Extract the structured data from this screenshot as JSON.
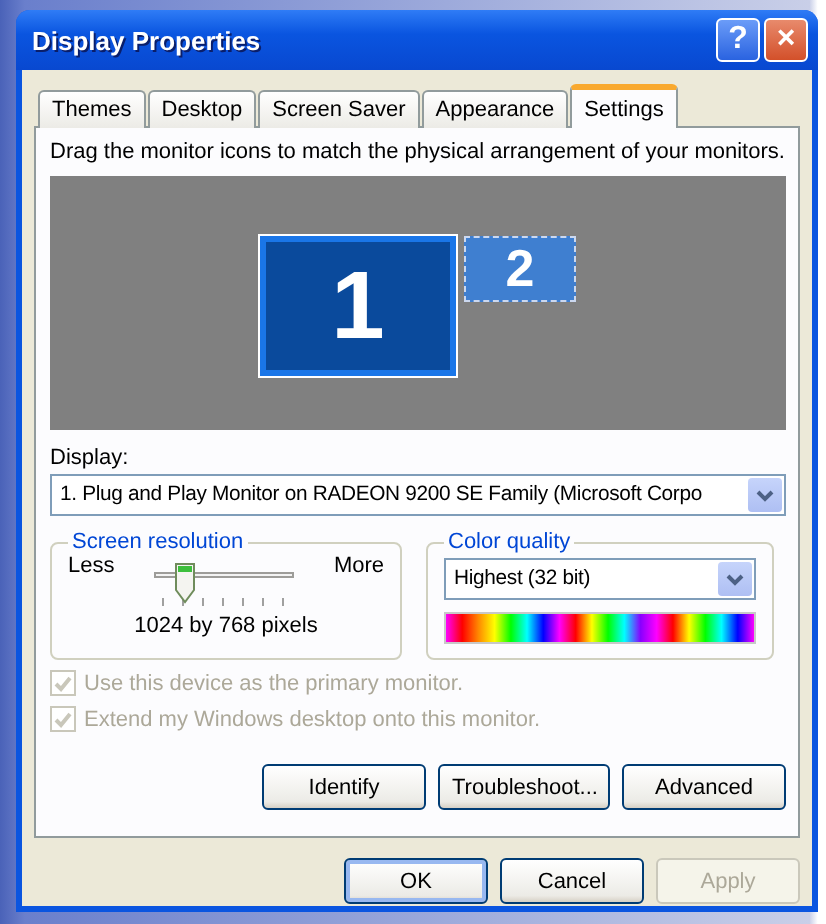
{
  "window": {
    "title": "Display Properties",
    "help_button": "?",
    "close_button": "×"
  },
  "tabs": [
    {
      "label": "Themes",
      "selected": false
    },
    {
      "label": "Desktop",
      "selected": false
    },
    {
      "label": "Screen Saver",
      "selected": false
    },
    {
      "label": "Appearance",
      "selected": false
    },
    {
      "label": "Settings",
      "selected": true
    }
  ],
  "instruction": "Drag the monitor icons to match the physical arrangement of your monitors.",
  "monitors": [
    {
      "label": "1",
      "selected": true
    },
    {
      "label": "2",
      "selected": false
    }
  ],
  "display": {
    "label": "Display:",
    "value": "1. Plug and Play Monitor on RADEON 9200 SE Family (Microsoft Corpo"
  },
  "screen_resolution": {
    "title": "Screen resolution",
    "less": "Less",
    "more": "More",
    "level": 0.17,
    "reading": "1024 by 768 pixels"
  },
  "color_quality": {
    "title": "Color quality",
    "value": "Highest (32 bit)"
  },
  "options": [
    {
      "label": "Use this device as the primary monitor.",
      "checked": true,
      "disabled": true
    },
    {
      "label": "Extend my Windows desktop onto this monitor.",
      "checked": true,
      "disabled": true
    }
  ],
  "panel_buttons": [
    "Identify",
    "Troubleshoot...",
    "Advanced"
  ],
  "dialog_buttons": [
    {
      "label": "OK",
      "disabled": false,
      "default": true
    },
    {
      "label": "Cancel",
      "disabled": false,
      "default": false
    },
    {
      "label": "Apply",
      "disabled": true,
      "default": false
    }
  ]
}
